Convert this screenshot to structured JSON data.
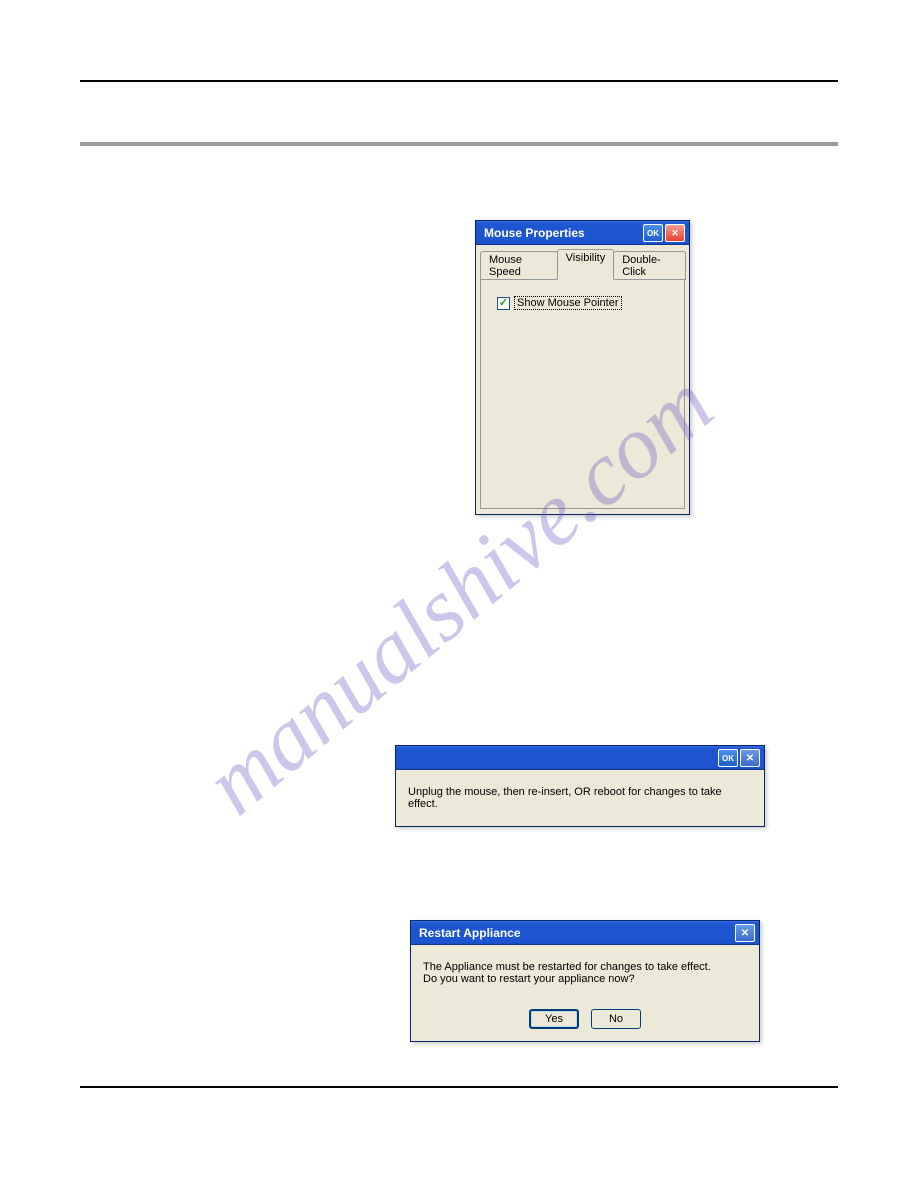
{
  "watermark": "manualshive.com",
  "mouseProps": {
    "title": "Mouse Properties",
    "okLabel": "OK",
    "tabs": {
      "speed": "Mouse Speed",
      "visibility": "Visibility",
      "doubleClick": "Double-Click"
    },
    "checkbox": {
      "checked": true,
      "label": "Show Mouse Pointer"
    }
  },
  "unplugDlg": {
    "okLabel": "OK",
    "message": "Unplug the mouse, then re-insert, OR reboot for changes to take effect."
  },
  "restartDlg": {
    "title": "Restart Appliance",
    "line1": "The Appliance must be restarted for changes to take effect.",
    "line2": "Do you want to restart your appliance now?",
    "yesLabel": "Yes",
    "noLabel": "No"
  }
}
